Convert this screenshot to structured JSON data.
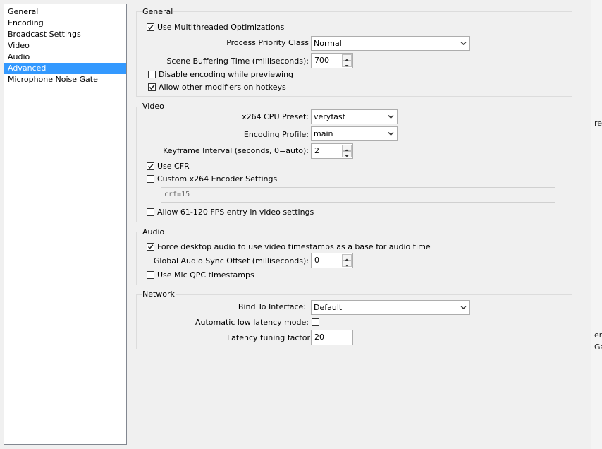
{
  "sidebar": {
    "items": [
      {
        "label": "General"
      },
      {
        "label": "Encoding"
      },
      {
        "label": "Broadcast Settings"
      },
      {
        "label": "Video"
      },
      {
        "label": "Audio"
      },
      {
        "label": "Advanced"
      },
      {
        "label": "Microphone Noise Gate"
      }
    ],
    "selected": "Advanced"
  },
  "general": {
    "title": "General",
    "multithreaded_label": "Use Multithreaded Optimizations",
    "multithreaded_checked": true,
    "priority_label": "Process Priority Class",
    "priority_value": "Normal",
    "buffering_label": "Scene Buffering Time (milliseconds):",
    "buffering_value": "700",
    "disable_preview_label": "Disable encoding while previewing",
    "disable_preview_checked": false,
    "modifiers_label": "Allow other modifiers on hotkeys",
    "modifiers_checked": true
  },
  "video": {
    "title": "Video",
    "preset_label": "x264 CPU Preset:",
    "preset_value": "veryfast",
    "profile_label": "Encoding Profile:",
    "profile_value": "main",
    "keyframe_label": "Keyframe Interval (seconds, 0=auto):",
    "keyframe_value": "2",
    "cfr_label": "Use CFR",
    "cfr_checked": true,
    "custom_label": "Custom x264 Encoder Settings",
    "custom_checked": false,
    "custom_value": "crf=15",
    "fps_label": "Allow 61-120 FPS entry in video settings",
    "fps_checked": false
  },
  "audio": {
    "title": "Audio",
    "force_label": "Force desktop audio to use video timestamps as a base for audio time",
    "force_checked": true,
    "sync_label": "Global Audio Sync Offset (milliseconds):",
    "sync_value": "0",
    "qpc_label": "Use Mic QPC timestamps",
    "qpc_checked": false
  },
  "network": {
    "title": "Network",
    "bind_label": "Bind To Interface:",
    "bind_value": "Default",
    "low_latency_label": "Automatic low latency mode:",
    "low_latency_checked": false,
    "latency_factor_label": "Latency tuning factor",
    "latency_factor_value": "20"
  },
  "edge_fragments": [
    "re",
    "erl",
    "Ga"
  ]
}
